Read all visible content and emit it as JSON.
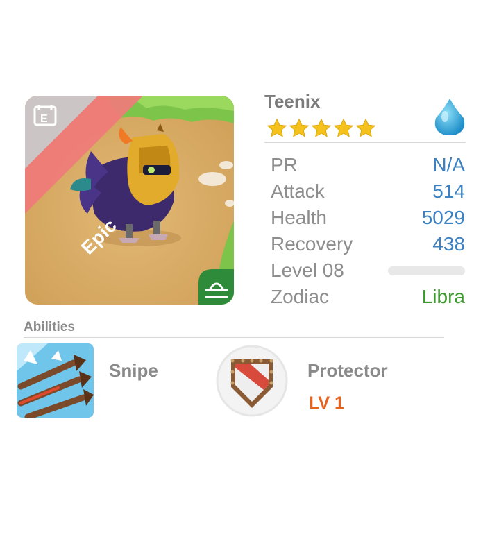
{
  "hero": {
    "name": "Teenix",
    "stars": 5,
    "rarity": "Epic",
    "element_icon": "water-drop-icon",
    "zodiac_icon": "libra-icon",
    "class_icon": "equipment-icon"
  },
  "stats": {
    "pr": {
      "label": "PR",
      "value": "N/A"
    },
    "attack": {
      "label": "Attack",
      "value": "514"
    },
    "health": {
      "label": "Health",
      "value": "5029"
    },
    "recovery": {
      "label": "Recovery",
      "value": "438"
    },
    "level": {
      "label": "Level 08",
      "progress": 0
    },
    "zodiac": {
      "label": "Zodiac",
      "value": "Libra"
    }
  },
  "abilities": {
    "title": "Abilities",
    "items": [
      {
        "name": "Snipe",
        "icon": "arrows-icon"
      },
      {
        "name": "Protector",
        "icon": "shield-icon",
        "level": "LV 1"
      }
    ]
  },
  "colors": {
    "stat_value": "#3d81c0",
    "zodiac_value": "#3b9b2c",
    "rarity_ribbon": "#f07a7a",
    "level_text": "#e5631e",
    "star": "#f4c21a"
  }
}
